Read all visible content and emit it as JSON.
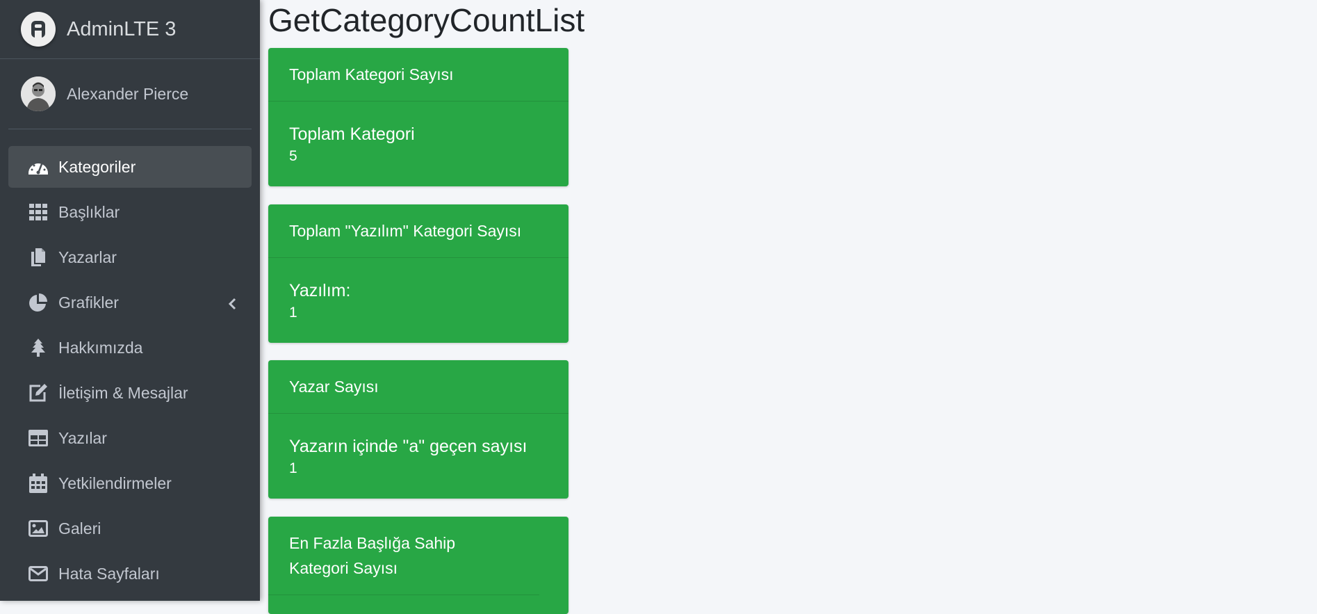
{
  "brand": {
    "name": "AdminLTE 3"
  },
  "user": {
    "name": "Alexander Pierce"
  },
  "sidebar": {
    "items": [
      {
        "label": "Kategoriler",
        "icon": "tachometer-icon",
        "active": true
      },
      {
        "label": "Başlıklar",
        "icon": "grid-icon"
      },
      {
        "label": "Yazarlar",
        "icon": "copy-icon"
      },
      {
        "label": "Grafikler",
        "icon": "pie-chart-icon",
        "has_submenu": true
      },
      {
        "label": "Hakkımızda",
        "icon": "tree-icon"
      },
      {
        "label": "İletişim & Mesajlar",
        "icon": "edit-icon"
      },
      {
        "label": "Yazılar",
        "icon": "table-icon"
      },
      {
        "label": "Yetkilendirmeler",
        "icon": "calendar-icon"
      },
      {
        "label": "Galeri",
        "icon": "image-icon"
      },
      {
        "label": "Hata Sayfaları",
        "icon": "envelope-icon"
      }
    ]
  },
  "main": {
    "title": "GetCategoryCountList",
    "cards": [
      {
        "header": "Toplam Kategori Sayısı",
        "title": "Toplam Kategori",
        "value": "5"
      },
      {
        "header": "Toplam \"Yazılım\" Kategori Sayısı",
        "title": "Yazılım:",
        "value": "1"
      },
      {
        "header": "Yazar Sayısı",
        "title": "Yazarın içinde \"a\" geçen sayısı",
        "value": "1"
      },
      {
        "header": "En Fazla Başlığa Sahip Kategori Sayısı"
      }
    ]
  },
  "colors": {
    "sidebar": "#343a40",
    "card": "#28a745",
    "background": "#f4f6f9"
  }
}
